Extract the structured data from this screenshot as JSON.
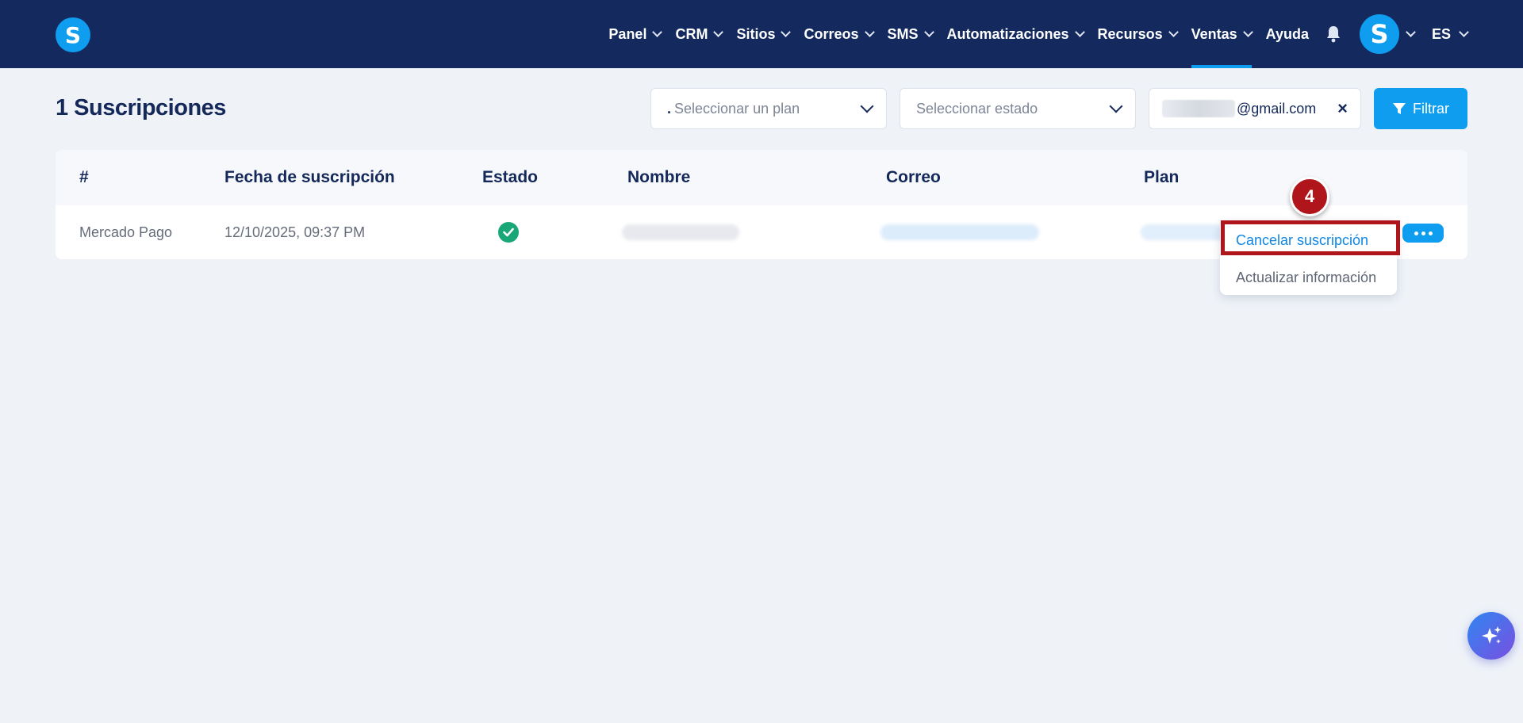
{
  "app": {
    "logo_letter": "S"
  },
  "nav": {
    "items": [
      {
        "label": "Panel",
        "has_dropdown": true
      },
      {
        "label": "CRM",
        "has_dropdown": true
      },
      {
        "label": "Sitios",
        "has_dropdown": true
      },
      {
        "label": "Correos",
        "has_dropdown": true
      },
      {
        "label": "SMS",
        "has_dropdown": true
      },
      {
        "label": "Automatizaciones",
        "has_dropdown": true
      },
      {
        "label": "Recursos",
        "has_dropdown": true
      },
      {
        "label": "Ventas",
        "has_dropdown": true,
        "active": true
      },
      {
        "label": "Ayuda",
        "has_dropdown": false
      }
    ],
    "avatar_letter": "S",
    "language": "ES"
  },
  "page": {
    "title": "1 Suscripciones"
  },
  "filters": {
    "plan_prefix": ".",
    "plan_placeholder": "Seleccionar un plan",
    "state_placeholder": "Seleccionar estado",
    "email_suffix": "@gmail.com",
    "clear_icon": "×",
    "filter_label": "Filtrar"
  },
  "table": {
    "columns": [
      "#",
      "Fecha de suscripción",
      "Estado",
      "Nombre",
      "Correo",
      "Plan"
    ],
    "rows": [
      {
        "id": "Mercado Pago",
        "date": "12/10/2025, 09:37 PM",
        "status": "active"
      }
    ]
  },
  "row_menu": {
    "items": [
      "Cancelar suscripción",
      "Actualizar información"
    ]
  },
  "annotation": {
    "step": "4"
  },
  "colors": {
    "nav_bg": "#142a5e",
    "accent": "#0f9df0",
    "highlight": "#b0151b",
    "success": "#1aa778"
  }
}
